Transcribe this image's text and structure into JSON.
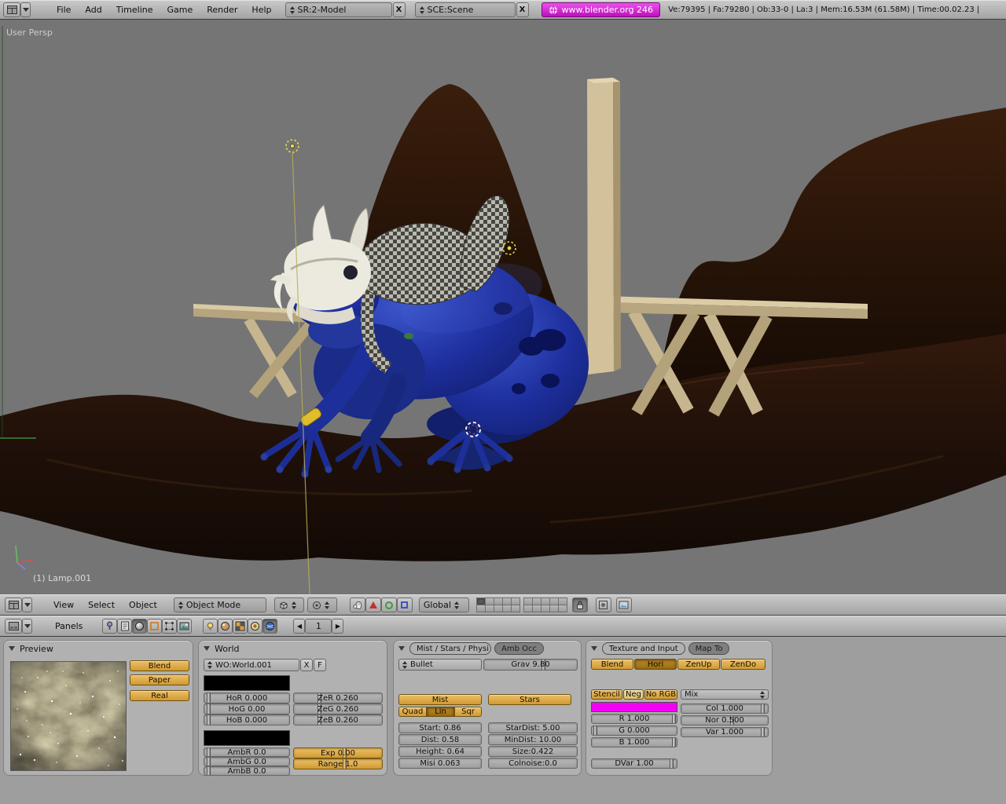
{
  "top_header": {
    "menus": [
      "File",
      "Add",
      "Timeline",
      "Game",
      "Render",
      "Help"
    ],
    "screen_selector": "SR:2-Model",
    "screen_close": "X",
    "scene_selector": "SCE:Scene",
    "scene_close": "X",
    "website_button": "www.blender.org 246",
    "stats": "Ve:79395 | Fa:79280 | Ob:33-0 | La:3 | Mem:16.53M (61.58M) | Time:00.02.23 |"
  },
  "viewport": {
    "view_label": "User Persp",
    "active_object": "(1) Lamp.001"
  },
  "viewport_header": {
    "menus": [
      "View",
      "Select",
      "Object"
    ],
    "mode": "Object Mode",
    "orientation": "Global"
  },
  "buttons_header": {
    "panels_label": "Panels",
    "frame_value": "1",
    "frame_prev": "◀",
    "frame_next": "▶"
  },
  "preview_panel": {
    "title": "Preview",
    "buttons": [
      "Blend",
      "Paper",
      "Real"
    ]
  },
  "world_panel": {
    "title": "World",
    "datablock": "WO:World.001",
    "unlink": "X",
    "fake_user": "F",
    "horizon": [
      "HoR 0.000",
      "HoG 0.00",
      "HoB 0.000"
    ],
    "zenith": [
      "ZeR 0.260",
      "ZeG 0.260",
      "ZeB 0.260"
    ],
    "ambient": [
      "AmbR 0.0",
      "AmbG 0.0",
      "AmbB 0.0"
    ],
    "exposure": "Exp 0.00",
    "range": "Range 1.0"
  },
  "mist_panel": {
    "tab_active": "Mist / Stars / Physi",
    "tab_inactive": "Amb Occ",
    "physics_engine": "Bullet",
    "gravity": "Grav 9.80",
    "mist_toggle": "Mist",
    "stars_toggle": "Stars",
    "falloff": [
      "Quad",
      "Lin",
      "Sqr"
    ],
    "mist_fields": [
      "Start: 0.86",
      "Dist: 0.58",
      "Height: 0.64",
      "Misi 0.063"
    ],
    "star_fields": [
      "StarDist: 5.00",
      "MinDist: 10.00",
      "Size:0.422",
      "Colnoise:0.0"
    ]
  },
  "texture_panel": {
    "tab_active": "Texture and Input",
    "tab_inactive": "Map To",
    "coords": [
      "Blend",
      "Hori",
      "ZenUp",
      "ZenDo"
    ],
    "modifiers": [
      "Stencil",
      "Neg",
      "No RGB"
    ],
    "blend_mode": "Mix",
    "color_sliders": [
      "R 1.000",
      "G 0.000",
      "B 1.000"
    ],
    "amount_sliders": [
      "Col 1.000",
      "Nor 0.500",
      "Var 1.000"
    ],
    "dvar": "DVar 1.00",
    "swatch_color": "#f400f4"
  }
}
